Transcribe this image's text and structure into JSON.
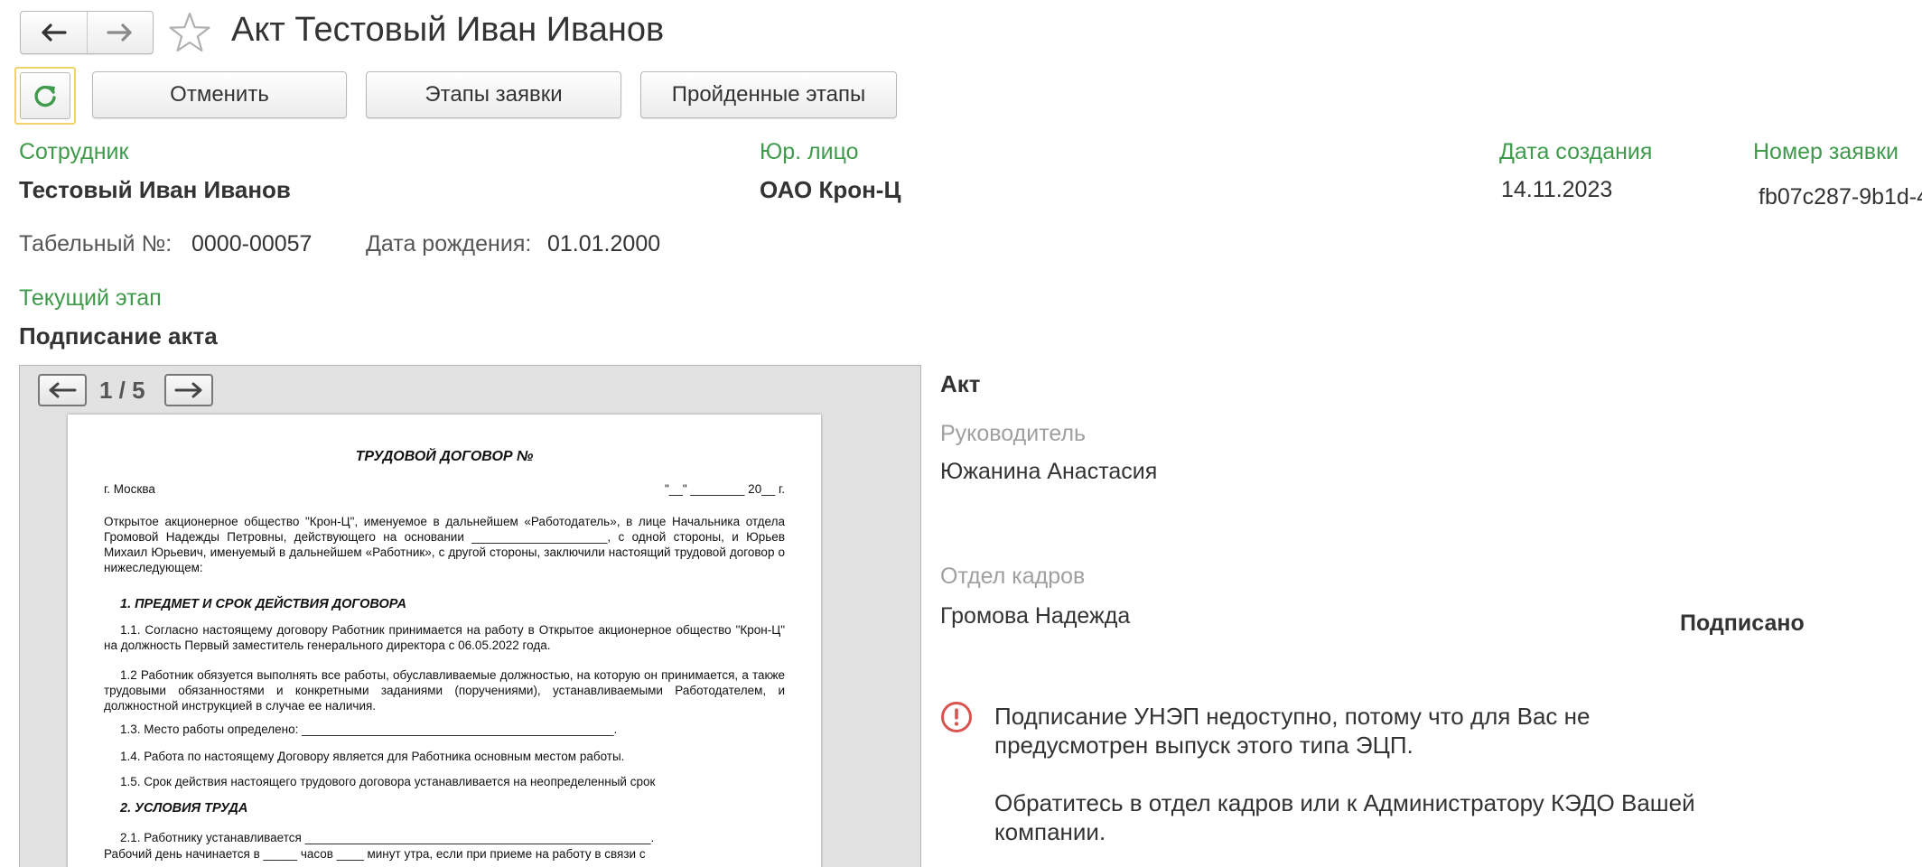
{
  "header": {
    "title": "Акт Тестовый Иван Иванов",
    "back_icon": "arrow-left-icon",
    "forward_icon": "arrow-right-icon",
    "favorite_icon": "star-icon",
    "refresh_icon": "refresh-icon"
  },
  "toolbar": {
    "cancel": "Отменить",
    "stages": "Этапы заявки",
    "passed_stages": "Пройденные этапы"
  },
  "fields": {
    "employee_label": "Сотрудник",
    "employee_value": "Тестовый Иван Иванов",
    "legal_label": "Юр. лицо",
    "legal_value": "ОАО Крон-Ц",
    "date_label": "Дата создания",
    "date_value": "14.11.2023",
    "number_label": "Номер заявки",
    "number_value": "fb07c287-9b1d-4",
    "tab_label": "Табельный №:",
    "tab_value": "0000-00057",
    "birth_label": "Дата рождения:",
    "birth_value": "01.01.2000",
    "stage_label": "Текущий этап",
    "stage_value": "Подписание акта"
  },
  "viewer": {
    "page_counter": "1 / 5",
    "prev_icon": "arrow-left-icon",
    "next_icon": "arrow-right-icon",
    "doc": {
      "title": "ТРУДОВОЙ ДОГОВОР №",
      "city": "г. Москва",
      "date_line": "\"__\" ________ 20__ г.",
      "intro": "Открытое акционерное общество \"Крон-Ц\", именуемое в дальнейшем «Работодатель», в лице Начальника отдела Громовой Надежды Петровны, действующего на основании ____________________, с одной стороны, и Юрьев Михаил Юрьевич, именуемый в дальнейшем «Работник», с другой стороны, заключили настоящий трудовой договор о нижеследующем:",
      "section1": "1. ПРЕДМЕТ И СРОК ДЕЙСТВИЯ ДОГОВОРА",
      "p1_1": "1.1. Согласно настоящему договору Работник принимается на работу в Открытое акционерное общество \"Крон-Ц\" на должность Первый заместитель генерального директора с 06.05.2022 года.",
      "p1_2": "1.2 Работник обязуется выполнять все работы, обуславливаемые должностью, на которую он принимается, а также трудовыми обязанностями и конкретными заданиями (поручениями), устанавливаемыми Работодателем, и должностной инструкцией в случае ее наличия.",
      "p1_3": "1.3. Место работы определено: ______________________________________________.",
      "p1_4": "1.4. Работа по настоящему Договору является для Работника основным местом работы.",
      "p1_5": "1.5. Срок действия настоящего трудового договора устанавливается на неопределенный срок",
      "section2": "2. УСЛОВИЯ ТРУДА",
      "p2_1": "2.1. Работнику устанавливается ___________________________________________________.",
      "p2_2": "Рабочий день начинается в _____ часов ____ минут утра, если при приеме на работу в связи с"
    }
  },
  "right_panel": {
    "act_label": "Акт",
    "manager_label": "Руководитель",
    "manager_value": "Южанина Анастасия",
    "hr_label": "Отдел кадров",
    "hr_value": "Громова Надежда",
    "signed_status": "Подписано",
    "warning_icon": "exclamation-circle-icon",
    "warning_line1": "Подписание УНЭП недоступно, потому что для Вас не",
    "warning_line2": "предусмотрен выпуск этого типа ЭЦП.",
    "warning_line3": "Обратитесь в отдел кадров или к Администратору КЭДО Вашей",
    "warning_line4": "компании."
  },
  "colors": {
    "label_green": "#3f9a4c",
    "warning_red": "#d9534f",
    "focus_yellow": "#f0d36a"
  }
}
